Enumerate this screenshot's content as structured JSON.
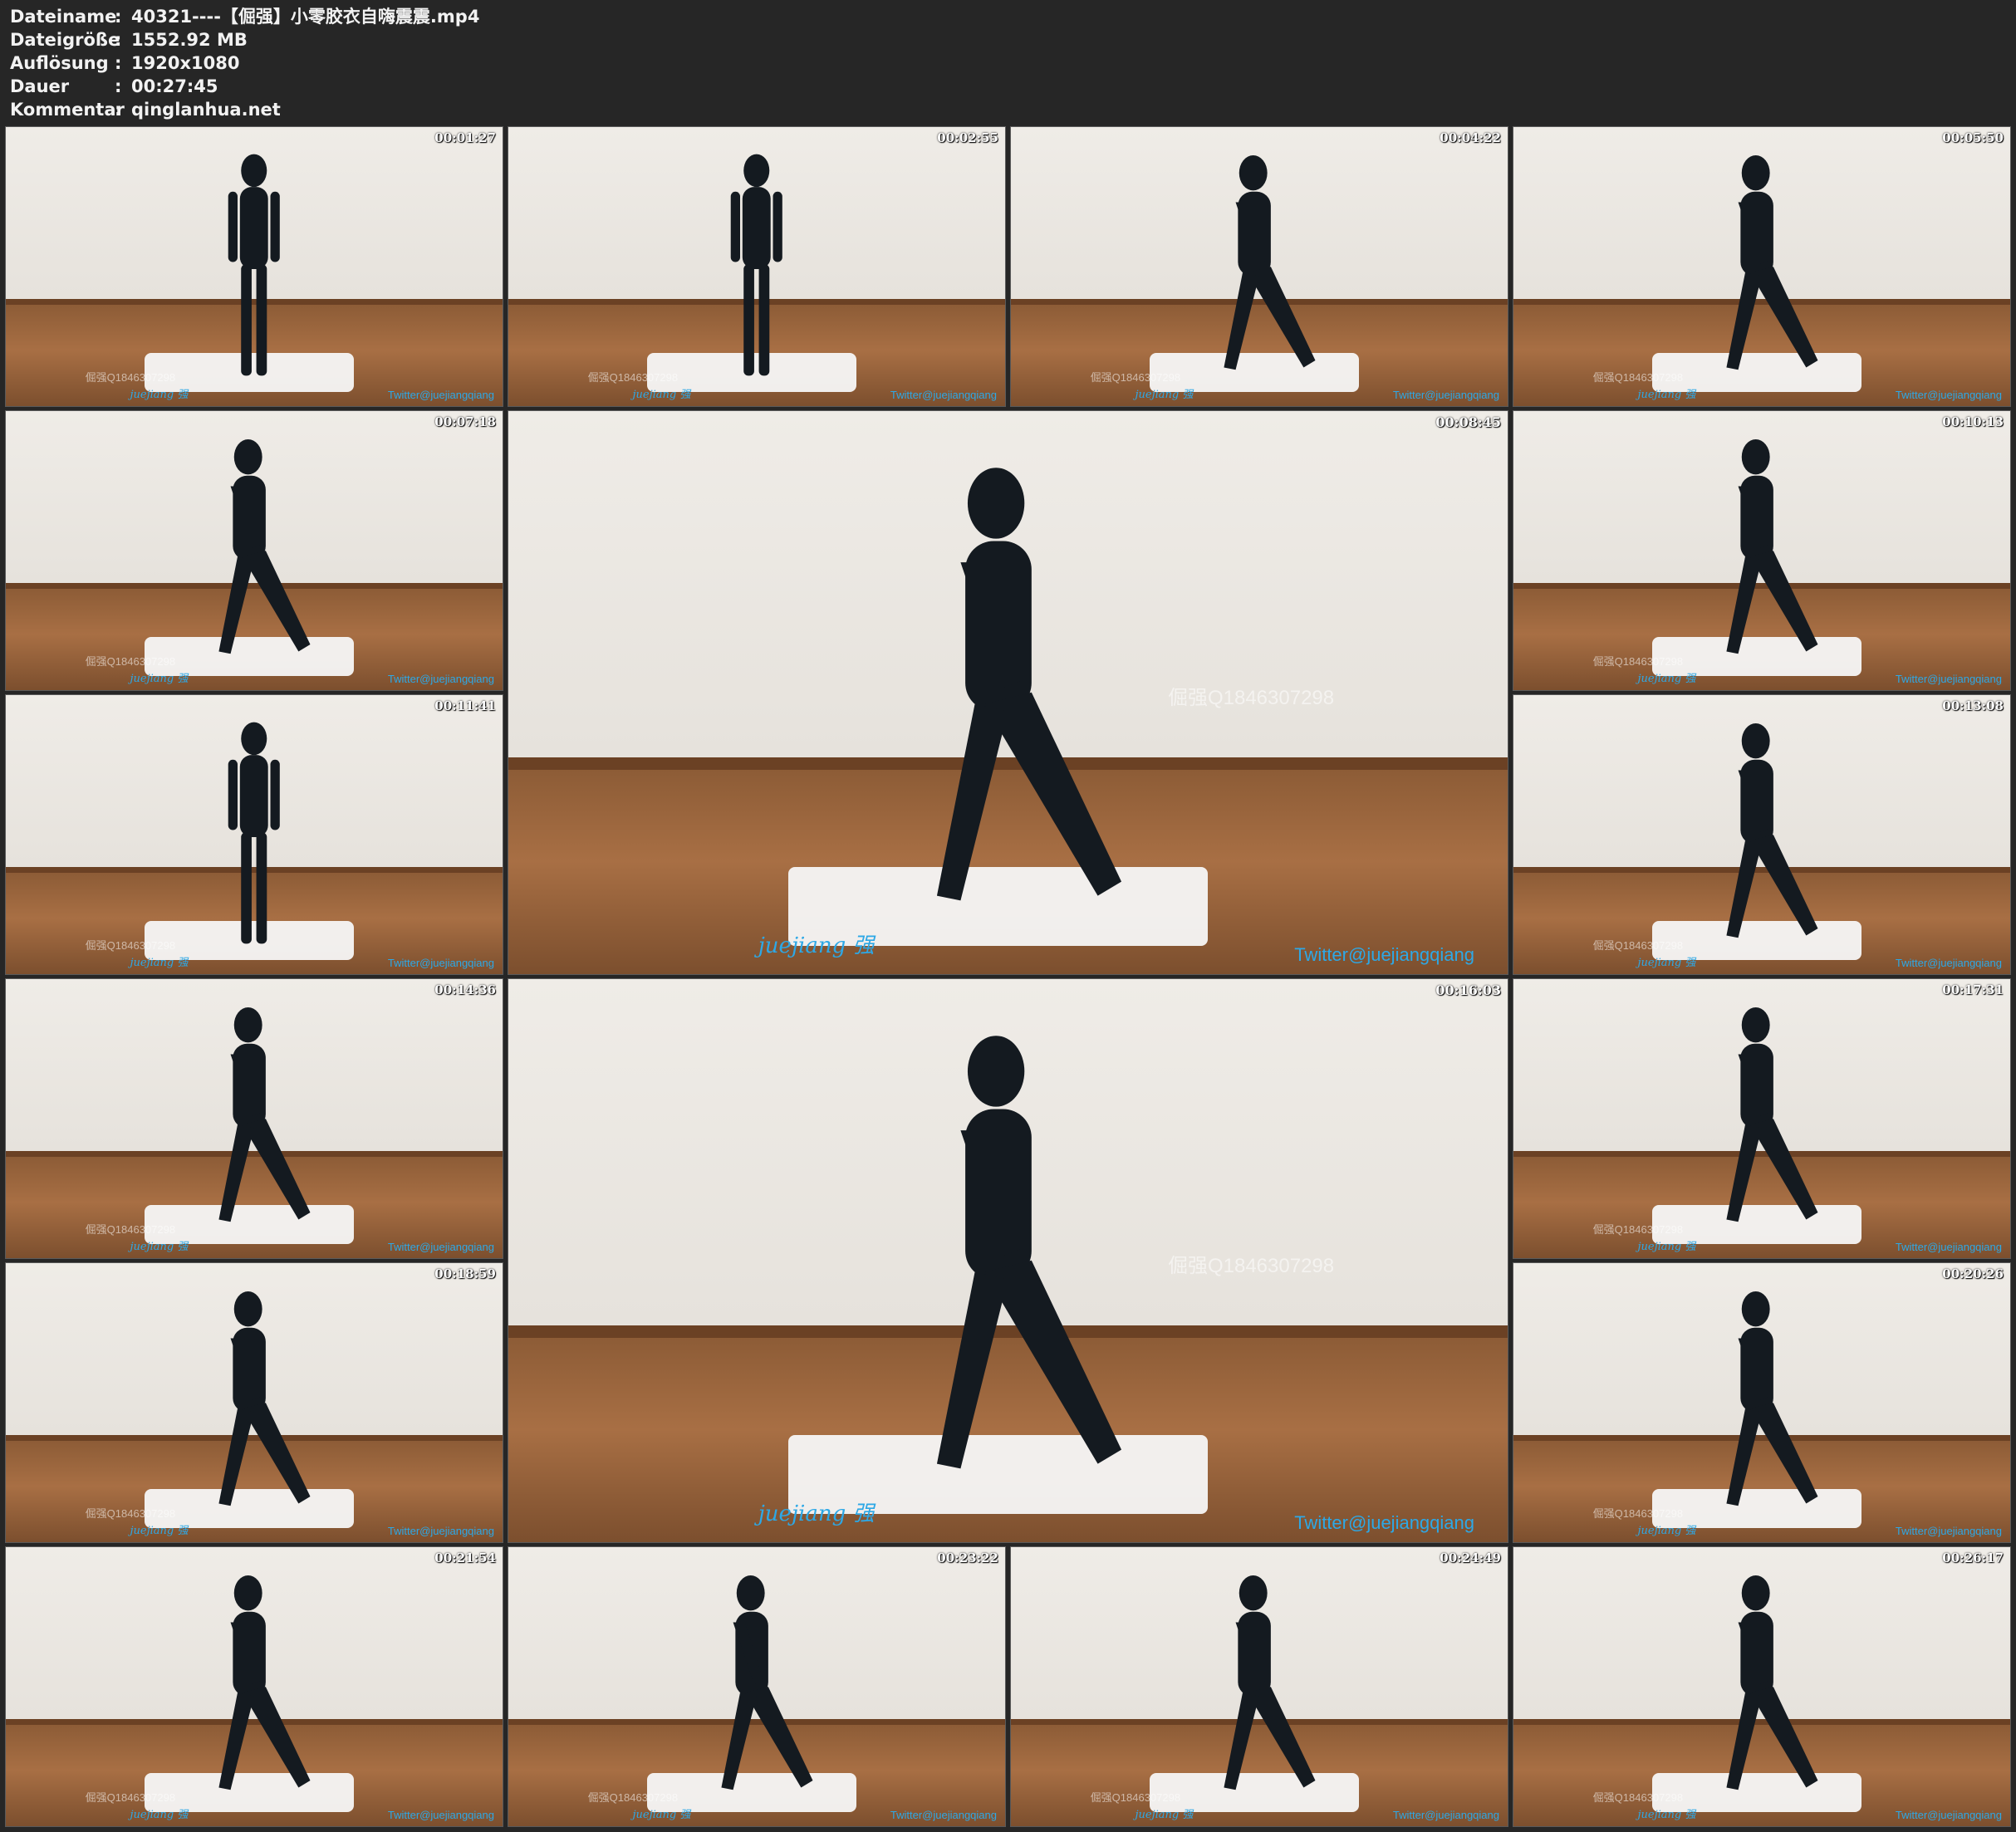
{
  "info": [
    {
      "label": "Dateiname",
      "value": "40321----【倔强】小零胶衣自嗨震震.mp4"
    },
    {
      "label": "Dateigröße",
      "value": "1552.92 MB"
    },
    {
      "label": "Auflösung",
      "value": "1920x1080"
    },
    {
      "label": "Dauer",
      "value": "00:27:45"
    },
    {
      "label": "Kommentar",
      "value": "qinglanhua.net"
    }
  ],
  "separator": ":",
  "thumbnails": [
    {
      "timestamp": "00:01:27"
    },
    {
      "timestamp": "00:02:55"
    },
    {
      "timestamp": "00:04:22"
    },
    {
      "timestamp": "00:05:50"
    },
    {
      "timestamp": "00:07:18"
    },
    {
      "timestamp": "00:08:45"
    },
    {
      "timestamp": "00:10:13"
    },
    {
      "timestamp": "00:11:41"
    },
    {
      "timestamp": "00:13:08"
    },
    {
      "timestamp": "00:14:36"
    },
    {
      "timestamp": "00:16:03"
    },
    {
      "timestamp": "00:17:31"
    },
    {
      "timestamp": "00:18:59"
    },
    {
      "timestamp": "00:20:26"
    },
    {
      "timestamp": "00:21:54"
    },
    {
      "timestamp": "00:23:22"
    },
    {
      "timestamp": "00:24:49"
    },
    {
      "timestamp": "00:26:17"
    }
  ],
  "watermarks": {
    "twitter": "Twitter@juejiangqiang",
    "brand": "juejiang 强",
    "qq": "倔强Q1846307298"
  }
}
